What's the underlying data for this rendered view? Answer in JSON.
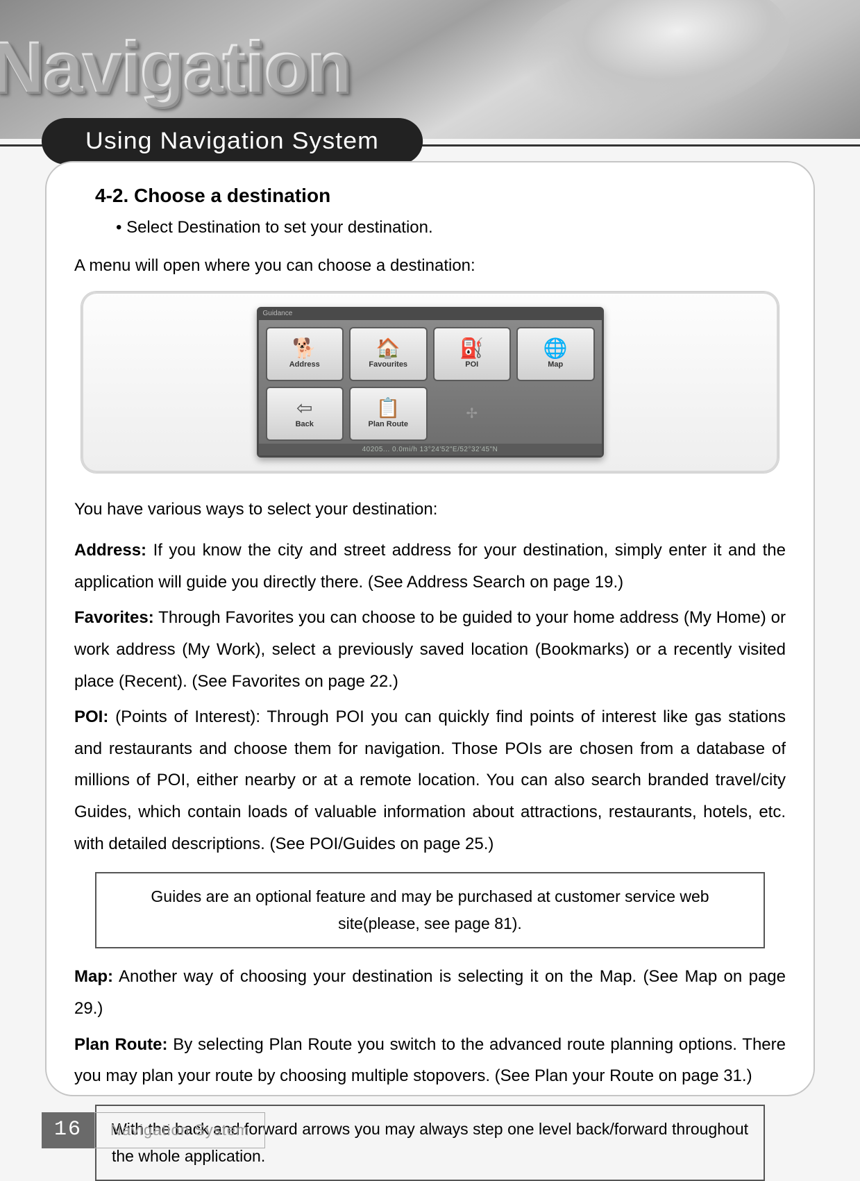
{
  "hero": {
    "title": "Navigation"
  },
  "tab": {
    "label": "Using Navigation System"
  },
  "section": {
    "heading": "4-2. Choose a destination"
  },
  "bullet": {
    "text": "Select Destination to set your destination."
  },
  "intro": {
    "text": "A menu will open where you can choose a destination:"
  },
  "gps": {
    "windowTitle": "Guidance",
    "buttons": {
      "address": "Address",
      "favourites": "Favourites",
      "poi": "POI",
      "map": "Map",
      "back": "Back",
      "plan": "Plan Route"
    },
    "status": "40205... 0.0mi/h  13°24'52\"E/52°32'45\"N"
  },
  "lead": {
    "text": "You have various ways to select your destination:"
  },
  "paras": {
    "address": {
      "label": "Address:",
      "text": " If you know the city and street address for your destination, simply enter it and the application will guide you directly there. (See Address Search on page 19.)"
    },
    "favorites": {
      "label": "Favorites:",
      "text": " Through Favorites you can choose to be guided to your home address (My Home) or work address (My Work), select a previously saved location (Bookmarks) or a recently visited place (Recent). (See Favorites on page 22.)"
    },
    "poi": {
      "label": "POI:",
      "text": " (Points of Interest): Through POI you can quickly find points of interest like gas stations and restaurants and choose them for navigation. Those POIs are chosen from a database of millions of POI, either nearby or at a remote location. You can also search branded travel/city Guides, which contain loads of valuable information about attractions, restaurants, hotels, etc. with detailed descriptions. (See POI/Guides on page 25.)"
    },
    "map": {
      "label": "Map:",
      "text": " Another way of choosing your destination is selecting it on the Map. (See Map on page 29.)"
    },
    "plan": {
      "label": "Plan Route:",
      "text": "  By selecting Plan Route you switch to the advanced route planning options. There you may plan your route by choosing multiple stopovers. (See Plan your Route on page 31.)"
    }
  },
  "notes": {
    "guides": "Guides are an optional feature and may be purchased at customer service web site(please, see page 81).",
    "arrows": "With the back and forward arrows you may always step one level back/forward throughout the whole application."
  },
  "footer": {
    "page": "16",
    "label": "Navigation System"
  }
}
